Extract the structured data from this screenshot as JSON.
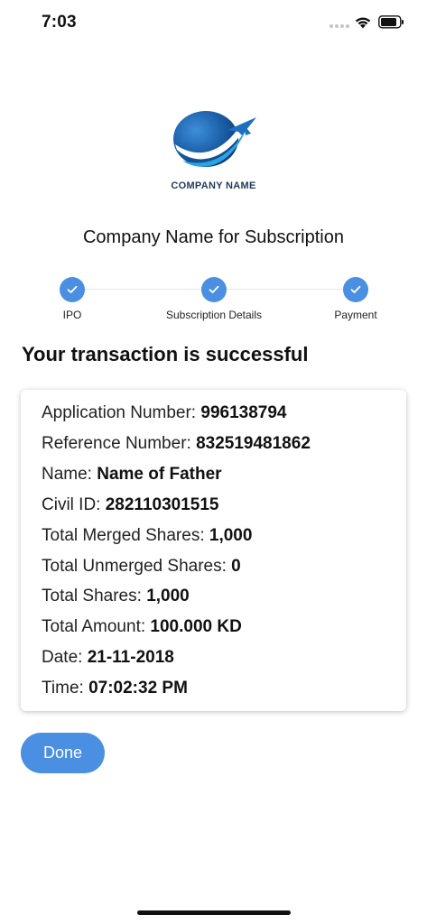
{
  "status_bar": {
    "time": "7:03"
  },
  "brand": {
    "logo_text": "COMPANY NAME",
    "logo_color": "#1f5fa8",
    "accent": "#4a8fe1"
  },
  "header": {
    "title": "Company Name for Subscription"
  },
  "stepper": {
    "steps": [
      {
        "label": "IPO",
        "completed": true
      },
      {
        "label": "Subscription Details",
        "completed": true
      },
      {
        "label": "Payment",
        "completed": true
      }
    ]
  },
  "result": {
    "heading": "Your transaction is successful",
    "fields": [
      {
        "label": "Application Number:",
        "value": "996138794"
      },
      {
        "label": "Reference Number:",
        "value": "832519481862"
      },
      {
        "label": "Name:",
        "value": "Name of Father"
      },
      {
        "label": "Civil ID:",
        "value": "282110301515"
      },
      {
        "label": "Total Merged Shares:",
        "value": "1,000"
      },
      {
        "label": "Total Unmerged Shares:",
        "value": "0"
      },
      {
        "label": "Total Shares:",
        "value": "1,000"
      },
      {
        "label": "Total Amount:",
        "value": "100.000 KD"
      },
      {
        "label": "Date:",
        "value": "21-11-2018"
      },
      {
        "label": "Time:",
        "value": "07:02:32 PM"
      }
    ]
  },
  "actions": {
    "done_label": "Done"
  }
}
